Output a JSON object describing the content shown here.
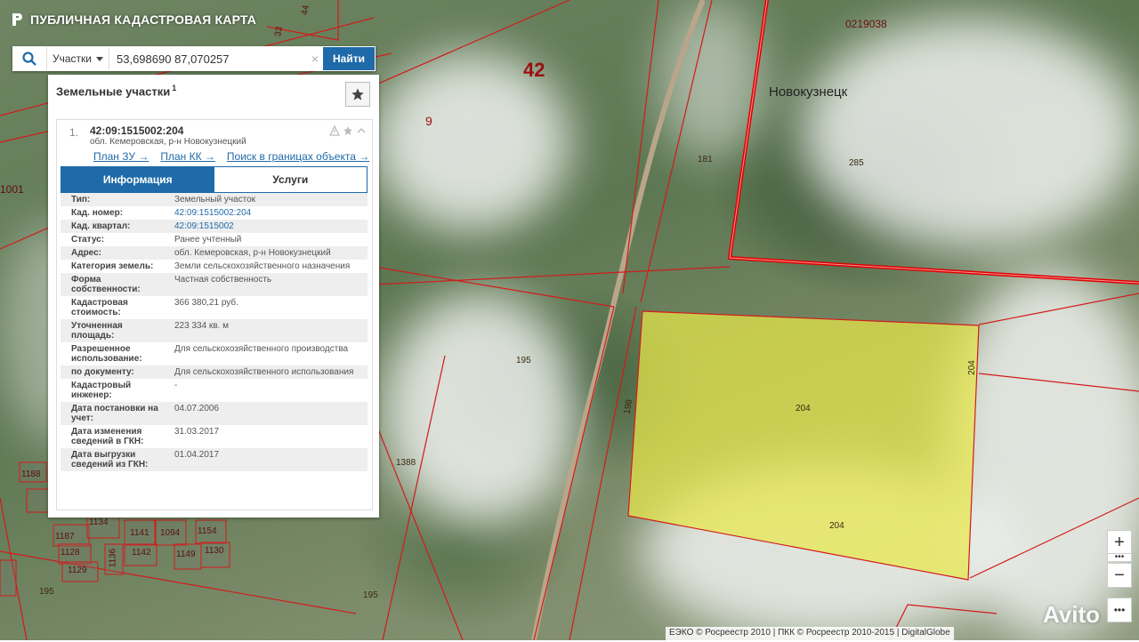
{
  "app": {
    "title": "ПУБЛИЧНАЯ КАДАСТРОВАЯ КАРТА"
  },
  "search": {
    "type_label": "Участки",
    "value": "53,698690 87,070257",
    "find_label": "Найти"
  },
  "panel": {
    "title": "Земельные участки",
    "count": "1",
    "result": {
      "index": "1.",
      "cad_number": "42:09:1515002:204",
      "address": "обл. Кемеровская, р-н Новокузнецкий",
      "links": [
        "План ЗУ →",
        "План КК →",
        "Поиск в границах объекта →"
      ],
      "tabs": [
        "Информация",
        "Услуги"
      ],
      "rows": [
        {
          "k": "Тип:",
          "v": "Земельный участок"
        },
        {
          "k": "Кад. номер:",
          "v": "42:09:1515002:204"
        },
        {
          "k": "Кад. квартал:",
          "v": "42:09:1515002"
        },
        {
          "k": "Статус:",
          "v": "Ранее учтенный"
        },
        {
          "k": "Адрес:",
          "v": "обл. Кемеровская, р-н Новокузнецкий"
        },
        {
          "k": "Категория земель:",
          "v": "Земли сельскохозяйственного назначения"
        },
        {
          "k": "Форма собственности:",
          "v": "Частная собственность"
        },
        {
          "k": "Кадастровая стоимость:",
          "v": "366 380,21 руб."
        },
        {
          "k": "Уточненная площадь:",
          "v": "223 334 кв. м"
        },
        {
          "k": "Разрешенное использование:",
          "v": "Для сельскохозяйственного производства"
        },
        {
          "k": "по документу:",
          "v": "Для сельскохозяйственного использования"
        },
        {
          "k": "Кадастровый инженер:",
          "v": "-"
        },
        {
          "k": "Дата постановки на учет:",
          "v": "04.07.2006"
        },
        {
          "k": "Дата изменения сведений в ГКН:",
          "v": "31.03.2017"
        },
        {
          "k": "Дата выгрузки сведений из ГКН:",
          "v": "01.04.2017"
        }
      ]
    }
  },
  "map": {
    "labels": {
      "district": "42",
      "city": "Новокузнецк",
      "n9": "9",
      "n181": "181",
      "n285": "285",
      "n195a": "195",
      "n195b": "195",
      "n195c": "195",
      "n198": "198",
      "n1388": "1388",
      "n204a": "204",
      "n204b": "204",
      "n204c": "204",
      "n0219038": "0219038",
      "n1001": "1001",
      "n33": "33",
      "n44": "44",
      "n1188": "1188",
      "n1187": "1187",
      "n1128": "1128",
      "n1129": "1129",
      "n1134": "1134",
      "n1141": "1141",
      "n1094": "1094",
      "n1154": "1154",
      "n1136": "1136",
      "n1142": "1142",
      "n1149": "1149",
      "n1130": "1130"
    },
    "parcel_color": "#e8e84a",
    "boundary_color": "#e00000"
  },
  "zoom": {
    "in": "+",
    "out": "−"
  },
  "attribution": "ЕЭКО © Росреестр 2010 | ПКК © Росреестр 2010-2015 | DigitalGlobe",
  "watermark": "Avito"
}
